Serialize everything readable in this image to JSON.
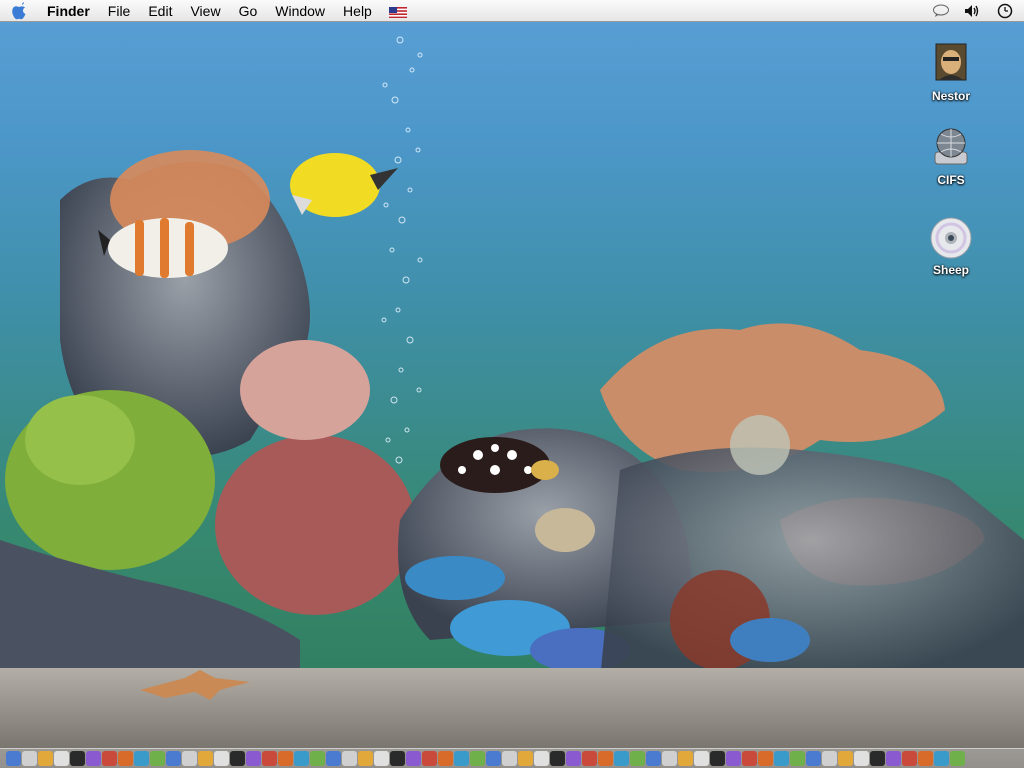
{
  "menubar": {
    "apple_icon": "apple-icon",
    "app_name": "Finder",
    "menus": [
      "File",
      "Edit",
      "View",
      "Go",
      "Window",
      "Help"
    ],
    "input_source_icon": "us-flag-icon",
    "status_icons": [
      "speech-bubble-icon",
      "volume-icon",
      "clock-icon"
    ]
  },
  "desktop_icons": [
    {
      "label": "Nestor",
      "icon": "user-portrait-icon"
    },
    {
      "label": "CIFS",
      "icon": "network-globe-drive-icon"
    },
    {
      "label": "Sheep",
      "icon": "cd-disc-icon"
    }
  ],
  "wallpaper": "aquarium-scene",
  "dock": {
    "item_count": 60
  },
  "colors": {
    "water_top": "#5a9fd6",
    "water_bottom": "#2f7a5a",
    "sand": "#8d8a85"
  }
}
